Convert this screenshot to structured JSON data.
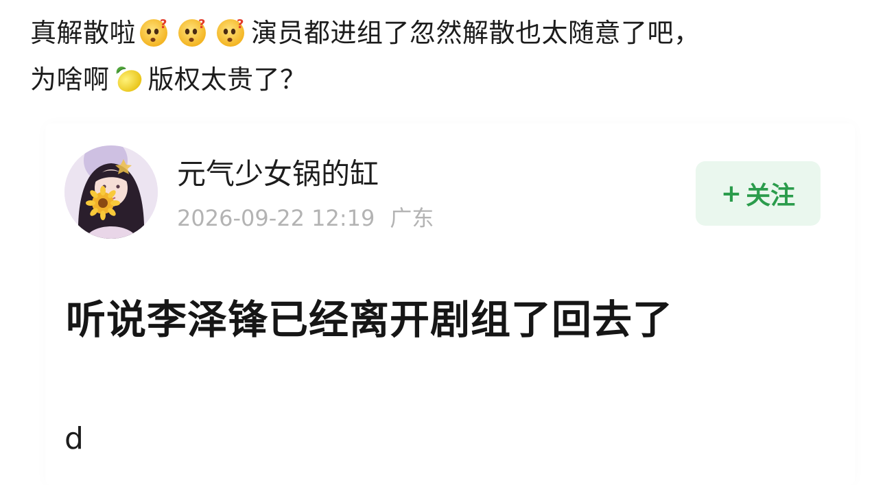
{
  "post": {
    "line1_a": "真解散啦",
    "line1_b": "演员都进组了忽然解散也太随意了吧，",
    "line2_a": "为啥啊",
    "line2_b": "版权太贵了？"
  },
  "icons": {
    "confused_face": "confused-face-icon",
    "lemon": "lemon-icon"
  },
  "screenshot": {
    "username": "元气少女锅的缸",
    "datetime": "2026-09-22 12:19",
    "location": "广东",
    "follow_plus": "+",
    "follow_label": "关注",
    "headline": "听说李泽锋已经离开剧组了回去了",
    "stray_text": "d"
  },
  "colors": {
    "follow_bg": "#eaf7ee",
    "follow_text": "#2b9c4c",
    "meta_text": "#b3b3b3"
  }
}
